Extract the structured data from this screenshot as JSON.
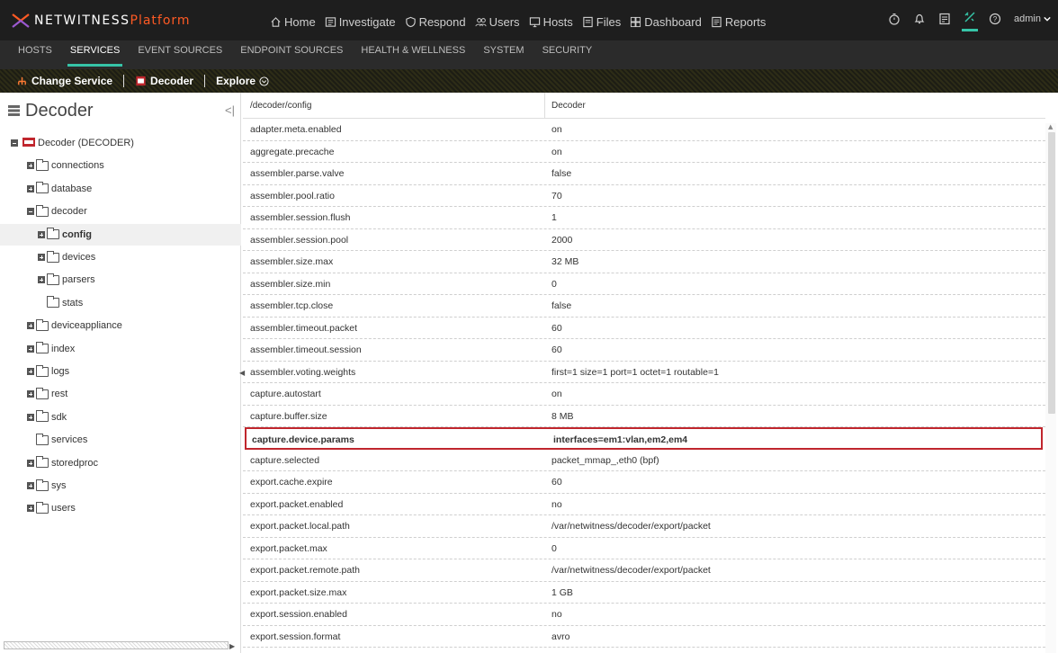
{
  "brand": {
    "name_a": "NETWITNESS",
    "name_b": "Platform"
  },
  "main_nav": [
    {
      "label": "Home",
      "icon": "home-icon"
    },
    {
      "label": "Investigate",
      "icon": "investigate-icon"
    },
    {
      "label": "Respond",
      "icon": "shield-icon"
    },
    {
      "label": "Users",
      "icon": "users-icon"
    },
    {
      "label": "Hosts",
      "icon": "hosts-icon"
    },
    {
      "label": "Files",
      "icon": "files-icon"
    },
    {
      "label": "Dashboard",
      "icon": "dashboard-icon"
    },
    {
      "label": "Reports",
      "icon": "reports-icon"
    }
  ],
  "top_right": {
    "user": "admin"
  },
  "sub_nav": [
    "HOSTS",
    "SERVICES",
    "EVENT SOURCES",
    "ENDPOINT SOURCES",
    "HEALTH & WELLNESS",
    "SYSTEM",
    "SECURITY"
  ],
  "toolbar": {
    "change_service": "Change Service",
    "decoder": "Decoder",
    "explore": "Explore"
  },
  "sidebar": {
    "title": "Decoder",
    "tree": [
      {
        "label": "Decoder (DECODER)",
        "type": "root"
      },
      {
        "label": "connections"
      },
      {
        "label": "database"
      },
      {
        "label": "decoder",
        "open": true
      },
      {
        "label": "config",
        "selected": true
      },
      {
        "label": "devices"
      },
      {
        "label": "parsers"
      },
      {
        "label": "stats"
      },
      {
        "label": "deviceappliance"
      },
      {
        "label": "index"
      },
      {
        "label": "logs"
      },
      {
        "label": "rest"
      },
      {
        "label": "sdk"
      },
      {
        "label": "services"
      },
      {
        "label": "storedproc"
      },
      {
        "label": "sys"
      },
      {
        "label": "users"
      }
    ]
  },
  "table": {
    "header": {
      "path": "/decoder/config",
      "value": "Decoder"
    },
    "rows": [
      [
        "adapter.meta.enabled",
        "on"
      ],
      [
        "aggregate.precache",
        "on"
      ],
      [
        "assembler.parse.valve",
        "false"
      ],
      [
        "assembler.pool.ratio",
        "70"
      ],
      [
        "assembler.session.flush",
        "1"
      ],
      [
        "assembler.session.pool",
        "2000"
      ],
      [
        "assembler.size.max",
        "32 MB"
      ],
      [
        "assembler.size.min",
        "0"
      ],
      [
        "assembler.tcp.close",
        "false"
      ],
      [
        "assembler.timeout.packet",
        "60"
      ],
      [
        "assembler.timeout.session",
        "60"
      ],
      [
        "assembler.voting.weights",
        "first=1 size=1 port=1 octet=1 routable=1"
      ],
      [
        "capture.autostart",
        "on"
      ],
      [
        "capture.buffer.size",
        "8 MB"
      ],
      [
        "capture.device.params",
        "interfaces=em1:vlan,em2,em4"
      ],
      [
        "capture.selected",
        "packet_mmap_,eth0 (bpf)"
      ],
      [
        "export.cache.expire",
        "60"
      ],
      [
        "export.packet.enabled",
        "no"
      ],
      [
        "export.packet.local.path",
        "/var/netwitness/decoder/export/packet"
      ],
      [
        "export.packet.max",
        "0"
      ],
      [
        "export.packet.remote.path",
        "/var/netwitness/decoder/export/packet"
      ],
      [
        "export.packet.size.max",
        "1 GB"
      ],
      [
        "export.session.enabled",
        "no"
      ],
      [
        "export.session.format",
        "avro"
      ]
    ],
    "highlighted_row": 14
  },
  "colors": {
    "accent": "#36c4a7",
    "brand_orange": "#ff5a24",
    "highlight_border": "#c0262d"
  }
}
